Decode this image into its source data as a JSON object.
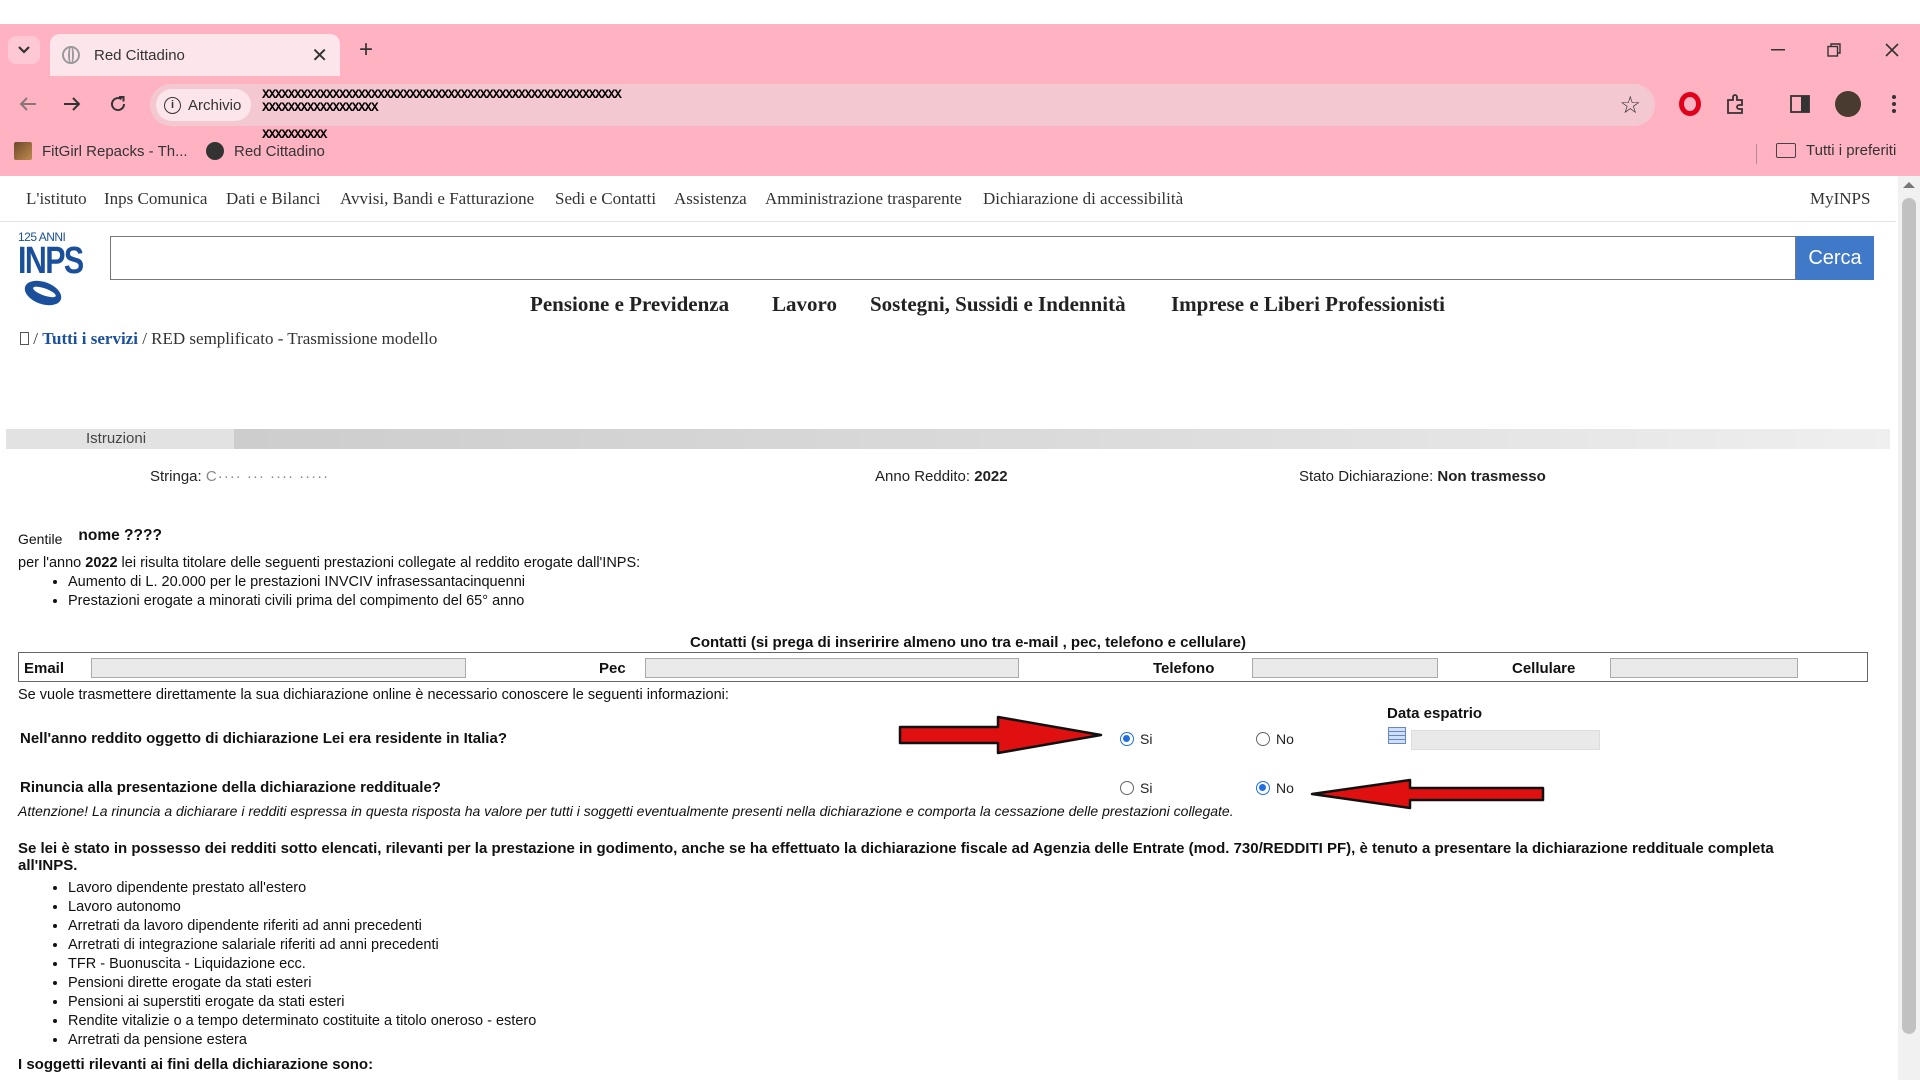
{
  "browser": {
    "tab_title": "Red Cittadino",
    "site_chip": "Archivio",
    "url_lines": [
      "XXXXXXXXXXXXXXXXXXXXXXXXXXXXXXXXXXXXXXXXXXXXXXXXXXXXXXXX",
      "XXXXXXXXXXXXXXXXXX",
      "XXXXXXXXXX"
    ],
    "bookmarks": [
      "FitGirl Repacks - Th...",
      "Red Cittadino"
    ],
    "all_bookmarks": "Tutti i preferiti"
  },
  "topnav": [
    "L'istituto",
    "Inps Comunica",
    "Dati e Bilanci",
    "Avvisi, Bandi e Fatturazione",
    "Sedi e Contatti",
    "Assistenza",
    "Amministrazione trasparente",
    "Dichiarazione di accessibilità"
  ],
  "topnav_right": "MyINPS",
  "logo": {
    "anni": "125 ANNI",
    "name": "INPS"
  },
  "search": {
    "button": "Cerca",
    "value": ""
  },
  "mainnav": [
    "Pensione e Previdenza",
    "Lavoro",
    "Sostegni, Sussidi e Indennità",
    "Imprese e Liberi Professionisti"
  ],
  "breadcrumb": {
    "sep1": " / ",
    "link": "Tutti i servizi",
    "sep2": " / ",
    "current": "RED semplificato - Trasmissione modello"
  },
  "step_label": "Istruzioni",
  "info": {
    "stringa_label": "Stringa: ",
    "stringa_value": "C···· ··· ···· ·····",
    "anno_label": "Anno Reddito: ",
    "anno_value": "2022",
    "stato_label": "Stato Dichiarazione: ",
    "stato_value": "Non trasmesso"
  },
  "greeting": {
    "gentile": "Gentile",
    "name": "nome ????"
  },
  "intro": {
    "pre": "per l'anno ",
    "year": "2022",
    "post": " lei risulta titolare delle seguenti prestazioni collegate al reddito erogate dall'INPS:"
  },
  "prestazioni": [
    "Aumento di L. 20.000 per le prestazioni INVCIV infrasessantacinquenni",
    "Prestazioni erogate a minorati civili prima del compimento del 65° anno"
  ],
  "contacts": {
    "title": "Contatti (si prega di inseririre almeno uno tra e-mail , pec, telefono e cellulare)",
    "email_label": "Email",
    "email_value": "",
    "pec_label": "Pec",
    "telefono_label": "Telefono",
    "cellulare_label": "Cellulare"
  },
  "online_info": "Se vuole trasmettere direttamente la sua dichiarazione online è necessario conoscere le seguenti informazioni:",
  "q1": {
    "label": "Nell'anno reddito oggetto di dichiarazione Lei era residente in Italia?",
    "yes": "Si",
    "no": "No",
    "selected": "Si"
  },
  "espatrio_label": "Data espatrio",
  "q2": {
    "label": "Rinuncia alla presentazione della dichiarazione reddituale?",
    "yes": "Si",
    "no": "No",
    "selected": "No"
  },
  "warning": "Attenzione! La rinuncia a dichiarare i redditi espressa in questa risposta ha valore per tutti i soggetti eventualmente presenti nella dichiarazione e comporta la cessazione delle prestazioni collegate.",
  "redditi_intro": "Se lei è stato in possesso dei redditi sotto elencati, rilevanti per la prestazione in godimento, anche se ha effettuato la dichiarazione fiscale ad Agenzia delle Entrate (mod. 730/REDDITI PF), è tenuto a presentare la dichiarazione reddituale completa all'INPS.",
  "redditi": [
    "Lavoro dipendente prestato all'estero",
    "Lavoro autonomo",
    "Arretrati da lavoro dipendente riferiti ad anni precedenti",
    "Arretrati di integrazione salariale riferiti ad anni precedenti",
    "TFR - Buonuscita - Liquidazione ecc.",
    "Pensioni dirette erogate da stati esteri",
    "Pensioni ai superstiti erogate da stati esteri",
    "Rendite vitalizie o a tempo determinato costituite a titolo oneroso - estero",
    "Arretrati da pensione estera"
  ],
  "soggetti_heading": "I soggetti rilevanti ai fini della dichiarazione sono:",
  "colors": {
    "chrome": "#ffb3c2",
    "accent": "#3f79c7",
    "arrow": "#e01010",
    "inps_blue": "#1a4f9c"
  }
}
